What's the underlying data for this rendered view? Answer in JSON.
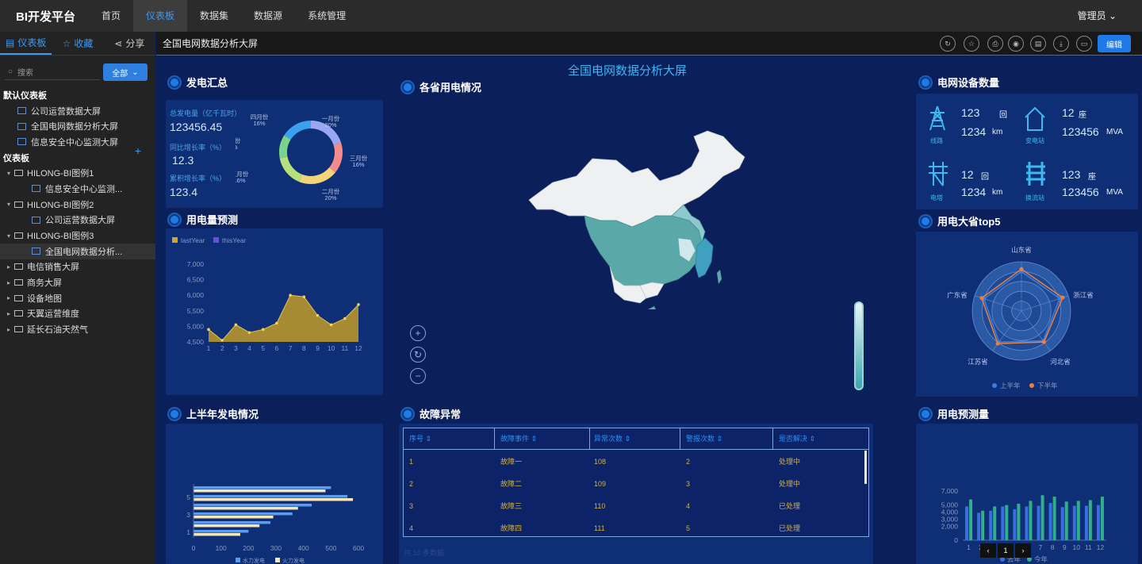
{
  "topbar": {
    "brand": "BI开发平台",
    "nav": [
      "首页",
      "仪表板",
      "数据集",
      "数据源",
      "系统管理"
    ],
    "user": "管理员 ⌄"
  },
  "sidebar": {
    "tabs": [
      "仪表板",
      "收藏",
      "分享"
    ],
    "search_placeholder": "搜索",
    "all_label": "全部",
    "tree": [
      {
        "t": "h",
        "label": "默认仪表板"
      },
      {
        "t": "d",
        "l": 1,
        "label": "公司运营数据大屏"
      },
      {
        "t": "d",
        "l": 1,
        "label": "全国电网数据分析大屏"
      },
      {
        "t": "d",
        "l": 1,
        "label": "信息安全中心监测大屏"
      },
      {
        "t": "h",
        "label": "仪表板"
      },
      {
        "t": "f",
        "open": true,
        "label": "HILONG-BI图例1"
      },
      {
        "t": "d",
        "l": 2,
        "label": "信息安全中心监测..."
      },
      {
        "t": "f",
        "open": true,
        "label": "HILONG-BI图例2"
      },
      {
        "t": "d",
        "l": 2,
        "label": "公司运营数据大屏"
      },
      {
        "t": "f",
        "open": true,
        "label": "HILONG-BI图例3"
      },
      {
        "t": "d",
        "l": 2,
        "label": "全国电网数据分析...",
        "sel": true
      },
      {
        "t": "f",
        "label": "电信销售大屏"
      },
      {
        "t": "f",
        "label": "商务大屏"
      },
      {
        "t": "f",
        "label": "设备地图"
      },
      {
        "t": "f",
        "label": "天翼运营维度"
      },
      {
        "t": "f",
        "label": "延长石油天然气"
      }
    ]
  },
  "subbar": {
    "title": "全国电网数据分析大屏",
    "edit": "编辑"
  },
  "screen": {
    "title": "全国电网数据分析大屏",
    "sections": {
      "gen": "发电汇总",
      "map": "各省用电情况",
      "devices": "电网设备数量",
      "forecast": "用电量预测",
      "top5": "用电大省top5",
      "half": "上半年发电情况",
      "fault": "故障异常",
      "predict": "用电预测量"
    },
    "kpis": [
      {
        "label": "总发电量（亿千瓦时）",
        "value": "123456.45"
      },
      {
        "label": "同比增长率（%）",
        "value": "12.3"
      },
      {
        "label": "累积增长率（%）",
        "value": "123.4"
      }
    ],
    "devices": [
      {
        "name": "线路",
        "v1": "123",
        "u1": "回",
        "v2": "1234",
        "u2": "km"
      },
      {
        "name": "变电站",
        "v1": "12",
        "u1": "座",
        "v2": "123456",
        "u2": "MVA"
      },
      {
        "name": "电塔",
        "v1": "12",
        "u1": "回",
        "v2": "1234",
        "u2": "km"
      },
      {
        "name": "换流站",
        "v1": "123",
        "u1": "座",
        "v2": "123456",
        "u2": "MVA"
      }
    ],
    "table": {
      "headers": [
        "序号",
        "故障事件",
        "异常次数",
        "警报次数",
        "是否解决"
      ],
      "rows": [
        [
          "1",
          "故障一",
          "108",
          "2",
          "处理中"
        ],
        [
          "2",
          "故障二",
          "109",
          "3",
          "处理中"
        ],
        [
          "3",
          "故障三",
          "110",
          "4",
          "已处理"
        ],
        [
          "4",
          "故障四",
          "111",
          "5",
          "已处理"
        ]
      ],
      "total": "共 10 条数据",
      "page": "1"
    }
  },
  "chart_data": [
    {
      "type": "pie",
      "title": "",
      "labels": [
        "一月份",
        "三月份",
        "二月份",
        "五月份",
        "六月份",
        "四月份"
      ],
      "values": [
        20,
        16,
        20,
        16,
        12,
        16
      ],
      "unit": "%",
      "colors": [
        "#9aa7f0",
        "#f28b8b",
        "#f4d47a",
        "#b6e07a",
        "#7ad38a",
        "#3aa0f0"
      ]
    },
    {
      "type": "area",
      "legend": [
        "lastYear",
        "thisYear"
      ],
      "x": [
        1,
        2,
        3,
        4,
        5,
        6,
        7,
        8,
        9,
        10,
        11,
        12
      ],
      "values": [
        4900,
        4550,
        5050,
        4800,
        4900,
        5100,
        6000,
        5950,
        5350,
        5050,
        5250,
        5700
      ],
      "ylim": [
        4500,
        7000
      ],
      "yticks": [
        "4,500",
        "5,000",
        "5,500",
        "6,000",
        "6,500",
        "7,000"
      ],
      "color": "#b8962e"
    },
    {
      "type": "radar",
      "indicators": [
        "山东省",
        "浙江省",
        "河北省",
        "江苏省",
        "广东省"
      ],
      "series": [
        {
          "name": "上半年",
          "values": [
            80,
            82,
            75,
            78,
            80
          ],
          "color": "#3a7ee0"
        },
        {
          "name": "下半年",
          "values": [
            85,
            88,
            78,
            82,
            85
          ],
          "color": "#f07f3a"
        }
      ]
    },
    {
      "type": "bar",
      "orientation": "horizontal",
      "categories": [
        "1",
        "2",
        "3",
        "4",
        "5",
        "6"
      ],
      "xticks": [
        "0",
        "100",
        "200",
        "300",
        "400",
        "500",
        "600"
      ],
      "xlim": [
        0,
        600
      ],
      "series": [
        {
          "name": "水力发电",
          "values": [
            200,
            280,
            360,
            430,
            560,
            500
          ],
          "color": "#5a9cf0"
        },
        {
          "name": "火力发电",
          "values": [
            170,
            240,
            290,
            380,
            580,
            480
          ],
          "color": "#f6e5b8"
        }
      ]
    },
    {
      "type": "bar",
      "categories": [
        "1",
        "2",
        "3",
        "4",
        "5",
        "6",
        "7",
        "8",
        "9",
        "10",
        "11",
        "12"
      ],
      "yticks": [
        "0",
        "2,000",
        "3,000",
        "4,000",
        "5,000",
        "7,000"
      ],
      "ylim": [
        0,
        7000
      ],
      "series": [
        {
          "name": "去年",
          "values": [
            4800,
            3900,
            4200,
            4800,
            4400,
            4800,
            4900,
            5300,
            4700,
            4900,
            4900,
            5000
          ],
          "color": "#3a6ee0"
        },
        {
          "name": "今年",
          "values": [
            5800,
            4200,
            4800,
            5000,
            5200,
            5600,
            6400,
            6200,
            5500,
            5600,
            5700,
            6200
          ],
          "color": "#2fb08a"
        }
      ]
    }
  ]
}
